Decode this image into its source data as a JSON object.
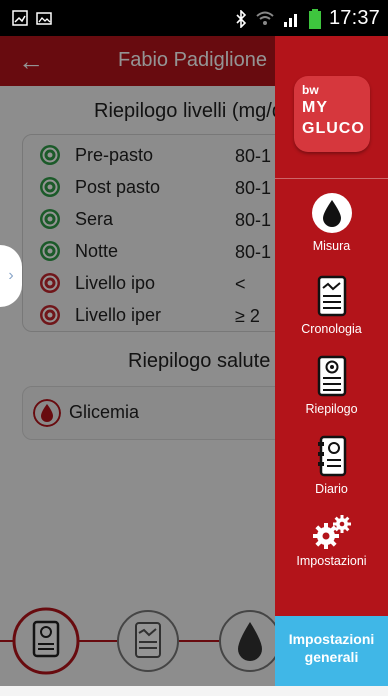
{
  "status": {
    "time": "17:37"
  },
  "header": {
    "title": "Fabio Padiglione"
  },
  "summary_levels": {
    "title": "Riepilogo livelli (mg/dl)",
    "rows": [
      {
        "label": "Pre-pasto",
        "value": "80-1",
        "status": "normal"
      },
      {
        "label": "Post pasto",
        "value": "80-1",
        "status": "normal"
      },
      {
        "label": "Sera",
        "value": "80-1",
        "status": "normal"
      },
      {
        "label": "Notte",
        "value": "80-1",
        "status": "normal"
      },
      {
        "label": "Livello ipo",
        "value": "<",
        "status": "alert"
      },
      {
        "label": "Livello iper",
        "value": "≥ 2",
        "status": "alert"
      }
    ]
  },
  "summary_health": {
    "title": "Riepilogo salute",
    "items": [
      {
        "label": "Glicemia"
      }
    ]
  },
  "drawer": {
    "logo": {
      "line1": "bw",
      "line2": "MY",
      "line3": "GLUCO"
    },
    "items": [
      {
        "label": "Misura",
        "icon": "drop-icon"
      },
      {
        "label": "Cronologia",
        "icon": "document-icon"
      },
      {
        "label": "Riepilogo",
        "icon": "report-icon"
      },
      {
        "label": "Diario",
        "icon": "diary-icon"
      },
      {
        "label": "Impostazioni",
        "icon": "gears-icon"
      }
    ],
    "general_settings": "Impostazioni generali"
  },
  "colors": {
    "brand_red": "#b3141a",
    "accent_blue": "#40b7e7",
    "ok_green": "#2f9b48",
    "alert_red": "#c1272d"
  }
}
